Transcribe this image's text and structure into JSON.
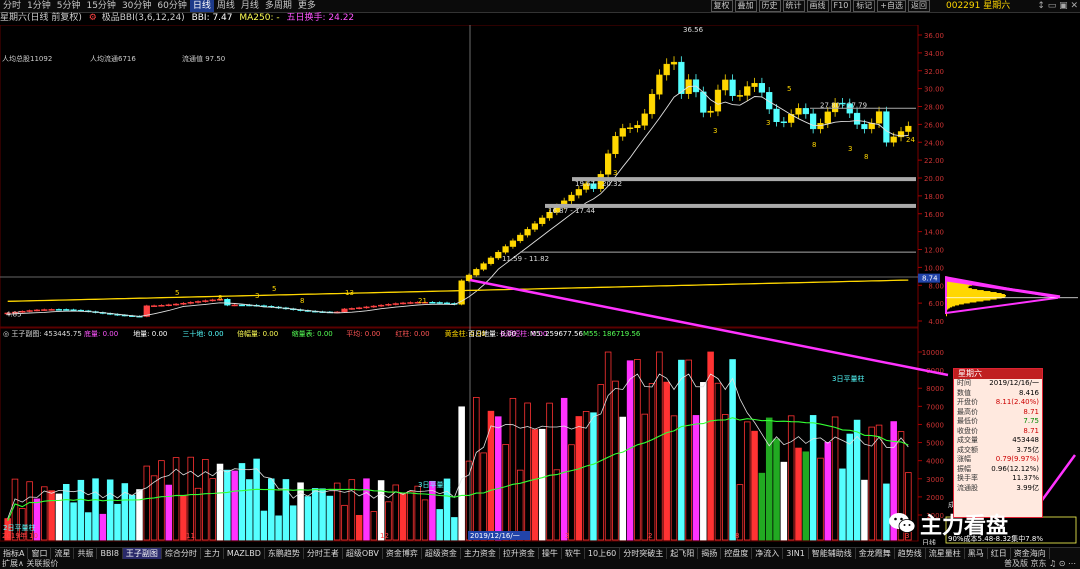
{
  "topbar": {
    "periods": [
      "分时",
      "1分钟",
      "5分钟",
      "15分钟",
      "30分钟",
      "60分钟",
      "日线",
      "周线",
      "月线",
      "多周期",
      "更多"
    ],
    "active_period": "日线",
    "buttons": [
      "复权",
      "叠加",
      "历史",
      "统计",
      "画线",
      "F10",
      "标记",
      "+自选",
      "返回"
    ],
    "stock_code": "002291 星期六",
    "right_icons": "↕ ▭ ▣ ✕"
  },
  "inforow": {
    "left": "星期六(日线 前复权)",
    "indicator_name": "极品BBI(3,6,12,24)",
    "bbi": "BBI: 7.47",
    "ma250": "MA250: -",
    "hsl": "五日换手: 24.22"
  },
  "main_panel": {
    "stats": [
      {
        "label": "人均总股11092"
      },
      {
        "label": "人均流通6716"
      },
      {
        "label": "流通值 97.50"
      }
    ],
    "price_axis": [
      "36.00",
      "34.00",
      "32.00",
      "30.00",
      "28.00",
      "26.00",
      "24.00",
      "22.00",
      "20.00",
      "18.00",
      "16.00",
      "14.00",
      "12.00",
      "10.00",
      "8.00",
      "6.00",
      "4.00"
    ],
    "current_price_label": "8.74",
    "annotations": [
      {
        "text": "36.56"
      },
      {
        "text": "27.80 - 27.79"
      },
      {
        "text": "19.67 - 20.32"
      },
      {
        "text": "16.87 - 17.44"
      },
      {
        "text": "11.59 - 11.82"
      },
      {
        "text": "4.85"
      }
    ],
    "count_labels": [
      "5",
      "8",
      "3",
      "5",
      "8",
      "13",
      "21",
      "3",
      "5",
      "3",
      "8",
      "3",
      "3",
      "8",
      "24"
    ]
  },
  "volume_panel": {
    "title": "王子副图: 453445.75",
    "tags": [
      {
        "text": "底量: 0.00",
        "color": "#ff55ff"
      },
      {
        "text": "地量: 0.00",
        "color": "#ffffff"
      },
      {
        "text": "三十地: 0.00",
        "color": "#55ffff"
      },
      {
        "text": "倍幅量: 0.00",
        "color": "#ffff55"
      },
      {
        "text": "缩量表: 0.00",
        "color": "#55ff55"
      },
      {
        "text": "平均: 0.00",
        "color": "#ff5555"
      },
      {
        "text": "红柱: 0.00",
        "color": "#ff5555"
      },
      {
        "text": "黄金柱: 0.00",
        "color": "#ffd700"
      },
      {
        "text": "长阴短柱: 0.00",
        "color": "#ff55ff"
      },
      {
        "text": "百日地量: 0.00",
        "color": "#ffffff"
      },
      {
        "text": "M5: 259677.56",
        "color": "#ffffff"
      },
      {
        "text": "M55: 186719.56",
        "color": "#55ff55"
      }
    ],
    "vol_axis": [
      "10000",
      "9000",
      "8000",
      "7000",
      "6000",
      "5000",
      "4000",
      "3000",
      "2000",
      "1000"
    ],
    "notes": [
      {
        "text": "3日平量柱",
        "color": "#55ffff"
      },
      {
        "text": "2日平量柱",
        "color": "#55ffff"
      },
      {
        "text": "3日平量柱",
        "color": "#55ffff"
      }
    ],
    "date_labels": [
      "2019年 10",
      "11",
      "12",
      "2019/12/16/一",
      "3",
      "2",
      "8",
      "3"
    ],
    "daily_label": "日线"
  },
  "popup": {
    "title": "星期六",
    "rows": [
      {
        "k": "时间",
        "v": "2019/12/16/一",
        "c": "vb"
      },
      {
        "k": "数值",
        "v": "8.416",
        "c": "vb"
      },
      {
        "k": "开盘价",
        "v": "8.11(2.40%)",
        "c": "v"
      },
      {
        "k": "最高价",
        "v": "8.71",
        "c": "v"
      },
      {
        "k": "最低价",
        "v": "7.75",
        "c": "vg"
      },
      {
        "k": "收盘价",
        "v": "8.71",
        "c": "v"
      },
      {
        "k": "成交量",
        "v": "453448",
        "c": "vb"
      },
      {
        "k": "成交额",
        "v": "3.75亿",
        "c": "vb"
      },
      {
        "k": "涨幅",
        "v": "0.79(9.97%)",
        "c": "v"
      },
      {
        "k": "振幅",
        "v": "0.96(12.12%)",
        "c": "vb"
      },
      {
        "k": "换手率",
        "v": "11.37%",
        "c": "vb"
      },
      {
        "k": "流通股",
        "v": "3.99亿",
        "c": "vb"
      }
    ]
  },
  "chip_panel": {
    "date_line": "成本分布,日期: 2019/12/18",
    "lines": [
      "90%成本5.48-8.32集中7.8%",
      "70%成本6.56-8.00集中3.9%"
    ]
  },
  "watermark": "主力看盘",
  "bottom_tabs": [
    "指标A",
    "窗口",
    "流星",
    "共振",
    "BBI8",
    "王子副图",
    "综合分时",
    "主力",
    "MAZLBD",
    "东鹏趋势",
    "分时王者",
    "超级OBV",
    "资金博弈",
    "超级资金",
    "主力资金",
    "拉升资金",
    "操牛",
    "软牛",
    "10上60",
    "分时突破主",
    "起飞阳",
    "揭扬",
    "控盘度",
    "净流入",
    "3IN1",
    "智能辅助线",
    "金龙霞舞",
    "趋势线",
    "流星量柱",
    "黑马",
    "红日",
    "资金海向"
  ],
  "bottom_active": "王子副图",
  "status": {
    "left": "扩展∧  关联报价",
    "right": "普及版 京东 ♫  ⊙ ⋯"
  },
  "colors": {
    "up": "#ff3333",
    "down": "#55ffff",
    "yellow": "#ffd700",
    "magenta": "#ff33ff",
    "green": "#33ff33",
    "grid": "#3a0000"
  }
}
